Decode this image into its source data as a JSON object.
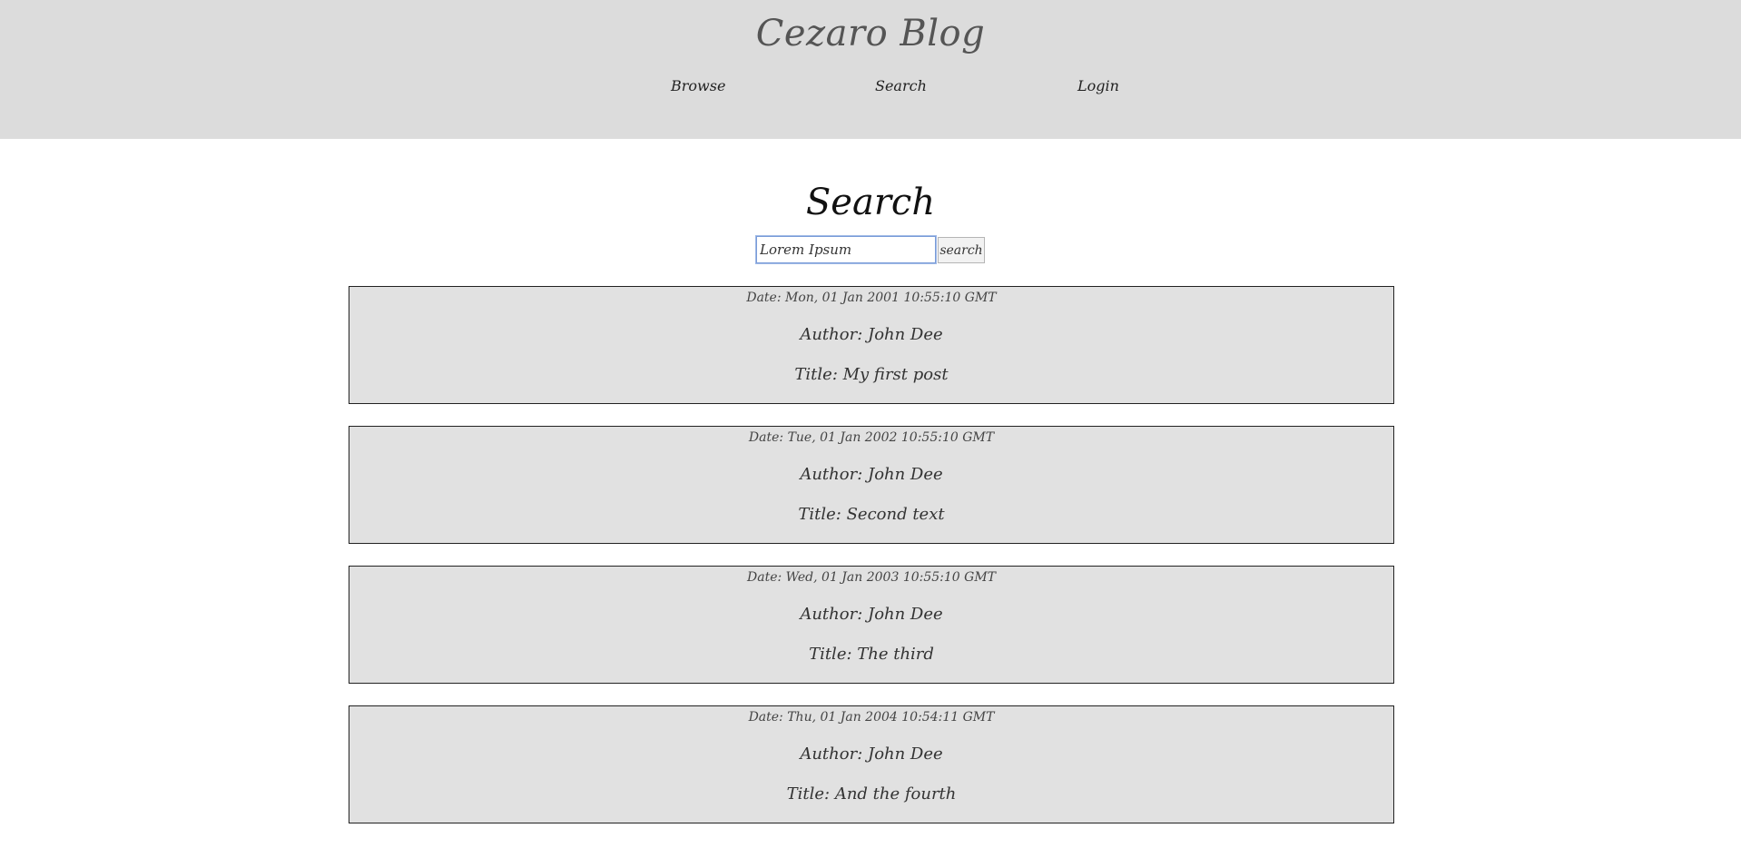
{
  "header": {
    "site_title": "Cezaro Blog",
    "nav": {
      "browse": "Browse",
      "search": "Search",
      "login": "Login"
    }
  },
  "main": {
    "title": "Search",
    "search": {
      "value": "Lorem Ipsum",
      "button_label": "search"
    },
    "posts": [
      {
        "date": "Date: Mon, 01 Jan 2001 10:55:10 GMT",
        "author": "Author: John Dee",
        "title": "Title: My first post"
      },
      {
        "date": "Date: Tue, 01 Jan 2002 10:55:10 GMT",
        "author": "Author: John Dee",
        "title": "Title: Second text"
      },
      {
        "date": "Date: Wed, 01 Jan 2003 10:55:10 GMT",
        "author": "Author: John Dee",
        "title": "Title: The third"
      },
      {
        "date": "Date: Thu, 01 Jan 2004 10:54:11 GMT",
        "author": "Author: John Dee",
        "title": "Title: And the fourth"
      }
    ]
  },
  "colors": {
    "header_bg": "#dcdcdc",
    "card_bg": "#e1e1e1",
    "card_border": "#222222",
    "input_focus_border": "#7a9cd8"
  }
}
